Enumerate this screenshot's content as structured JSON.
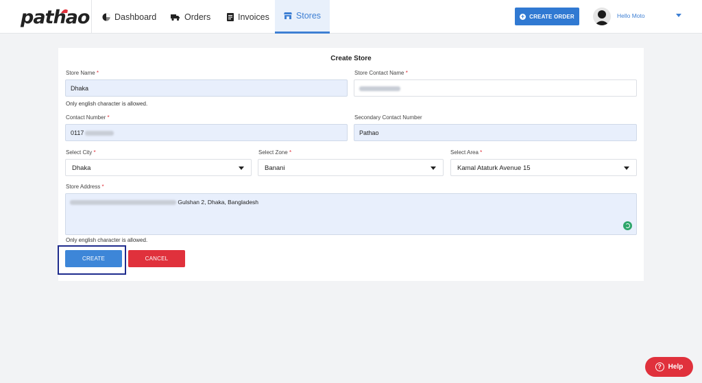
{
  "header": {
    "logo_text": "pathao",
    "nav": {
      "dashboard": "Dashboard",
      "orders": "Orders",
      "invoices": "Invoices",
      "stores": "Stores"
    },
    "create_order_label": "CREATE ORDER",
    "user_name": "Hello Moto",
    "accent_color": "#3079d2"
  },
  "form": {
    "title": "Create Store",
    "store_name": {
      "label": "Store Name",
      "value": "Dhaka",
      "hint": "Only english character is allowed."
    },
    "store_contact_name": {
      "label": "Store Contact Name"
    },
    "contact_number": {
      "label": "Contact Number",
      "value": "0117"
    },
    "secondary_contact_number": {
      "label": "Secondary Contact Number",
      "value": "Pathao"
    },
    "city": {
      "label": "Select City",
      "value": "Dhaka"
    },
    "zone": {
      "label": "Select Zone",
      "value": "Banani"
    },
    "area": {
      "label": "Select Area",
      "value": "Kamal Ataturk Avenue 15"
    },
    "address": {
      "label": "Store Address",
      "value": "Gulshan 2,  Dhaka, Bangladesh",
      "hint": "Only english character is allowed."
    },
    "required_mark": "*",
    "create_label": "CREATE",
    "cancel_label": "CANCEL"
  },
  "help": {
    "label": "Help"
  },
  "colors": {
    "primary": "#3d86d8",
    "danger": "#e0313c",
    "field_bg": "#e8effc"
  }
}
